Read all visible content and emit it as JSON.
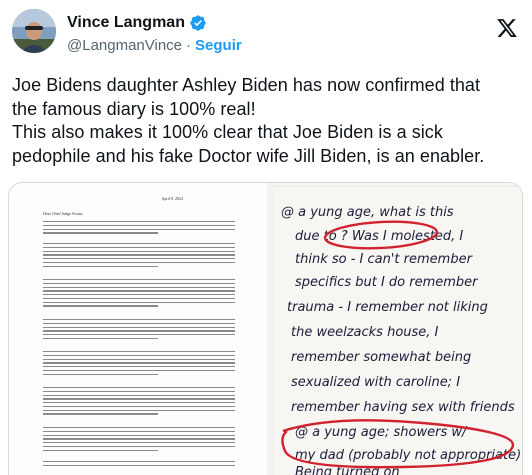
{
  "author": {
    "name": "Vince Langman",
    "handle": "@LangmanVince",
    "separator": "·",
    "follow_label": "Seguir",
    "verified": true
  },
  "tweet": {
    "lines": [
      "Joe Bidens daughter Ashley Biden has now confirmed that",
      "the famous diary is 100% real!",
      "This also makes it 100% clear that Joe Biden is a sick",
      "pedophile and his fake Doctor wife Jill Biden, is an enabler."
    ]
  },
  "media": {
    "letter": {
      "date": "April 8, 2024",
      "greeting": "Dear Chief Judge Swain,"
    },
    "diary": {
      "lines": [
        "@ a yung age, what is this",
        "due to ? Was I molested, I",
        "think so - I can't remember",
        "specifics but I do remember",
        "trauma - I remember not liking",
        "the weelzacks house, I",
        "remember somewhat being",
        "sexualized with caroline; I",
        "remember having sex with friends",
        "@ a yung age; showers w/",
        "my dad (probably not appropriate)",
        "Being turned on"
      ]
    }
  },
  "colors": {
    "accent": "#1d9bf0",
    "text": "#0f1419",
    "secondary": "#536471",
    "ink": "#1b1d3a",
    "marker": "#d0232f"
  },
  "icons": {
    "verified": "verified-badge-icon",
    "x": "x-logo-icon"
  }
}
